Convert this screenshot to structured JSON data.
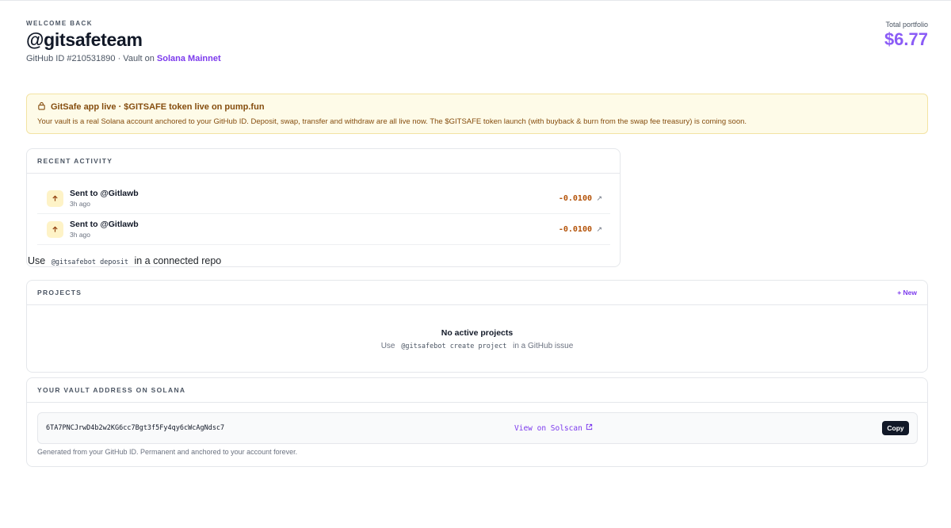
{
  "header": {
    "eyebrow": "WELCOME BACK",
    "handle": "@gitsafeteam",
    "github_id_text": "GitHub ID #210531890 · Vault on",
    "network": "Solana Mainnet"
  },
  "portfolio": {
    "label": "Total portfolio",
    "value": "$6.77"
  },
  "banner": {
    "icon": "lock-icon",
    "title": "GitSafe app live · $GITSAFE token live on pump.fun",
    "body": "Your vault is a real Solana account anchored to your GitHub ID. Deposit, swap, transfer and withdraw are all live now. The $GITSAFE token launch (with buyback & burn from the swap fee treasury) is coming soon."
  },
  "activity": {
    "title": "RECENT ACTIVITY",
    "items": [
      {
        "title": "Sent to @Gitlawb",
        "time": "3h ago",
        "amount": "-0.0100",
        "icon": "arrow-up-icon"
      },
      {
        "title": "Sent to @Gitlawb",
        "time": "3h ago",
        "amount": "-0.0100",
        "icon": "arrow-up-icon"
      }
    ],
    "hint_prefix": "Use",
    "hint_code": "@gitsafebot deposit",
    "hint_suffix": "in a connected repo"
  },
  "projects": {
    "title": "PROJECTS",
    "new_label": "+ New",
    "empty_title": "No active projects",
    "empty_prefix": "Use",
    "empty_code": "@gitsafebot create project",
    "empty_suffix": "in a GitHub issue"
  },
  "vault": {
    "title": "YOUR VAULT ADDRESS ON SOLANA",
    "address": "6TA7PNCJrwD4b2w2KG6cc7Bgt3f5Fy4qy6cWcAgNdsc7",
    "solscan_label": "View on Solscan",
    "copy_label": "Copy",
    "note": "Generated from your GitHub ID. Permanent and anchored to your account forever."
  },
  "colors": {
    "accent": "#8b5cf6",
    "banner_bg": "#fefbe8",
    "amount": "#b45309"
  }
}
